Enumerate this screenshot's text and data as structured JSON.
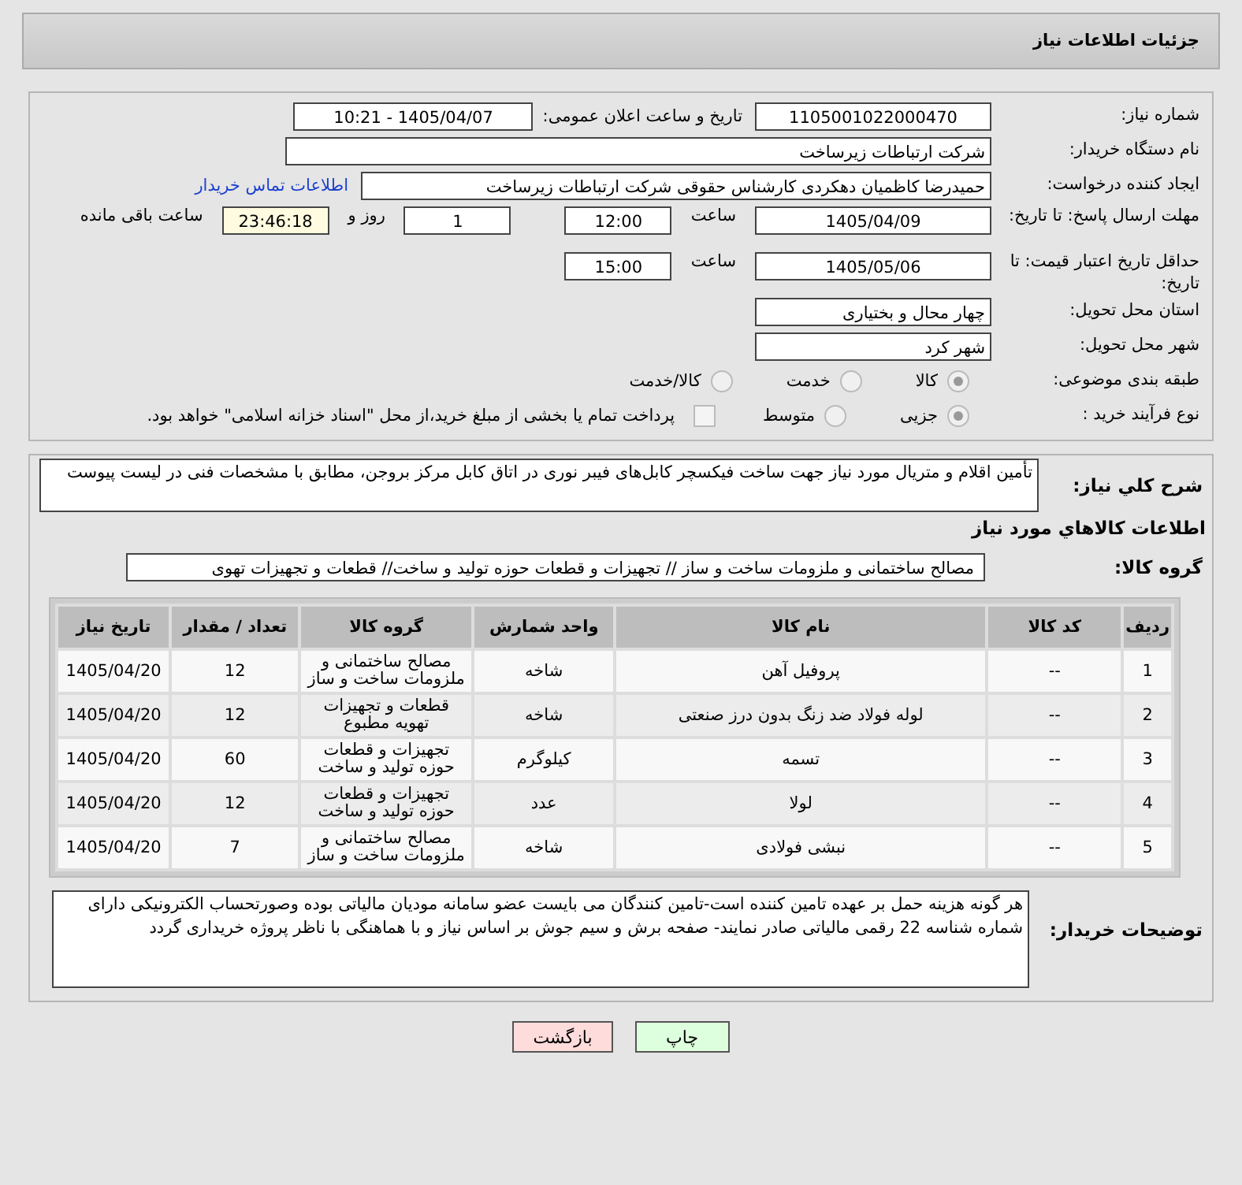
{
  "header": {
    "title": "جزئیات اطلاعات نیاز"
  },
  "info": {
    "need_number_label": "شماره نیاز:",
    "need_number": "1105001022000470",
    "announce_label": "تاریخ و ساعت اعلان عمومی:",
    "announce_value": "1405/04/07 - 10:21",
    "buyer_label": "نام دستگاه خریدار:",
    "buyer": "شرکت ارتباطات زیرساخت",
    "creator_label": "ایجاد کننده درخواست:",
    "creator": "حمیدرضا کاظمیان دهکردی کارشناس حقوقی شرکت ارتباطات زیرساخت",
    "contact_link": "اطلاعات تماس خریدار",
    "deadline_label": "مهلت ارسال پاسخ: تا تاریخ:",
    "deadline_date": "1405/04/09",
    "time_label": "ساعت",
    "deadline_time": "12:00",
    "days": "1",
    "days_label": "روز و",
    "remaining": "23:46:18",
    "remaining_label": "ساعت باقی مانده",
    "validity_label": "حداقل تاریخ اعتبار قیمت: تا تاریخ:",
    "validity_date": "1405/05/06",
    "validity_time_label": "ساعت",
    "validity_time": "15:00",
    "province_label": "استان محل تحویل:",
    "province": "چهار محال و بختیاری",
    "city_label": "شهر محل تحویل:",
    "city": "شهر کرد",
    "category_label": "طبقه بندی موضوعی:",
    "categories": [
      {
        "label": "کالا",
        "selected": true
      },
      {
        "label": "خدمت",
        "selected": false
      },
      {
        "label": "کالا/خدمت",
        "selected": false
      }
    ],
    "process_label": "نوع فرآیند خرید :",
    "processes": [
      {
        "label": "جزیی",
        "selected": true
      },
      {
        "label": "متوسط",
        "selected": false
      }
    ],
    "treasury": {
      "label": "پرداخت تمام یا بخشی از مبلغ خرید،از محل \"اسناد خزانه اسلامی\" خواهد بود.",
      "checked": false
    }
  },
  "details": {
    "summary_label": "شرح کلي نیاز:",
    "summary": "تأمین اقلام و متریال  مورد نیاز جهت ساخت فیکسچر کابل‌های فیبر نوری در اتاق کابل مرکز بروجن،  مطابق با مشخصات فنی در لیست پیوست",
    "goods_title": "اطلاعات کالاهاي مورد نیاز",
    "group_label": "گروه کالا:",
    "group": "مصالح ساختمانی و ملزومات ساخت و ساز // تجهیزات و قطعات حوزه تولید و ساخت//  قطعات و تجهیزات تهوی"
  },
  "table": {
    "columns": [
      "ردیف",
      "کد کالا",
      "نام کالا",
      "واحد شمارش",
      "گروه کالا",
      "تعداد / مقدار",
      "تاریخ نیاز"
    ],
    "rows": [
      [
        "1",
        "--",
        "پروفیل آهن",
        "شاخه",
        "مصالح ساختمانی و ملزومات ساخت و ساز",
        "12",
        "1405/04/20"
      ],
      [
        "2",
        "--",
        "لوله فولاد ضد زنگ بدون درز صنعتی",
        "شاخه",
        "قطعات و تجهیزات تهویه مطبوع",
        "12",
        "1405/04/20"
      ],
      [
        "3",
        "--",
        "تسمه",
        "کیلوگرم",
        "تجهیزات و قطعات حوزه تولید و ساخت",
        "60",
        "1405/04/20"
      ],
      [
        "4",
        "--",
        "لولا",
        "عدد",
        "تجهیزات و قطعات حوزه تولید و ساخت",
        "12",
        "1405/04/20"
      ],
      [
        "5",
        "--",
        "نبشی فولادی",
        "شاخه",
        "مصالح ساختمانی و ملزومات ساخت و ساز",
        "7",
        "1405/04/20"
      ]
    ]
  },
  "notes": {
    "label": "توضیحات خریدار:",
    "text": "هر گونه هزینه حمل بر عهده تامین کننده است-تامین کنندگان می بایست عضو سامانه مودیان مالیاتی بوده وصورتحساب الکترونیکی دارای شماره شناسه 22 رقمی مالیاتی صادر نمایند- صفحه برش و سیم جوش بر اساس نیاز و با هماهنگی با ناظر پروژه خریداری گردد"
  },
  "buttons": [
    {
      "label": "چاپ",
      "kind": "print"
    },
    {
      "label": "بازگشت",
      "kind": "back"
    }
  ]
}
